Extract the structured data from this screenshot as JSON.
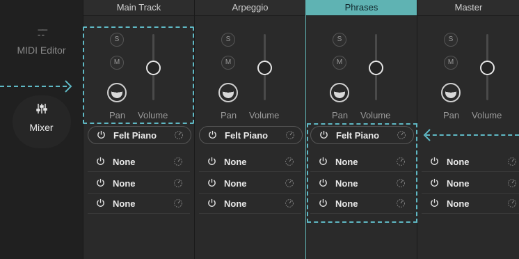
{
  "sidebar": {
    "midi_editor": {
      "label": "MIDI Editor",
      "icon": "midi-icon"
    },
    "mixer": {
      "label": "Mixer",
      "icon": "sliders-icon"
    }
  },
  "channels": [
    {
      "name": "Main Track",
      "solo": "S",
      "mute": "M",
      "pan_label": "Pan",
      "volume_label": "Volume",
      "slots": [
        "Felt Piano",
        "None",
        "None",
        "None"
      ]
    },
    {
      "name": "Arpeggio",
      "solo": "S",
      "mute": "M",
      "pan_label": "Pan",
      "volume_label": "Volume",
      "slots": [
        "Felt Piano",
        "None",
        "None",
        "None"
      ]
    },
    {
      "name": "Phrases",
      "solo": "S",
      "mute": "M",
      "pan_label": "Pan",
      "volume_label": "Volume",
      "slots": [
        "Felt Piano",
        "None",
        "None",
        "None"
      ]
    },
    {
      "name": "Master",
      "solo": "S",
      "mute": "M",
      "pan_label": "Pan",
      "volume_label": "Volume",
      "slots": [
        "None",
        "None",
        "None"
      ]
    }
  ],
  "colors": {
    "accent": "#5fb3b3",
    "dashed": "#5fb8c4"
  }
}
